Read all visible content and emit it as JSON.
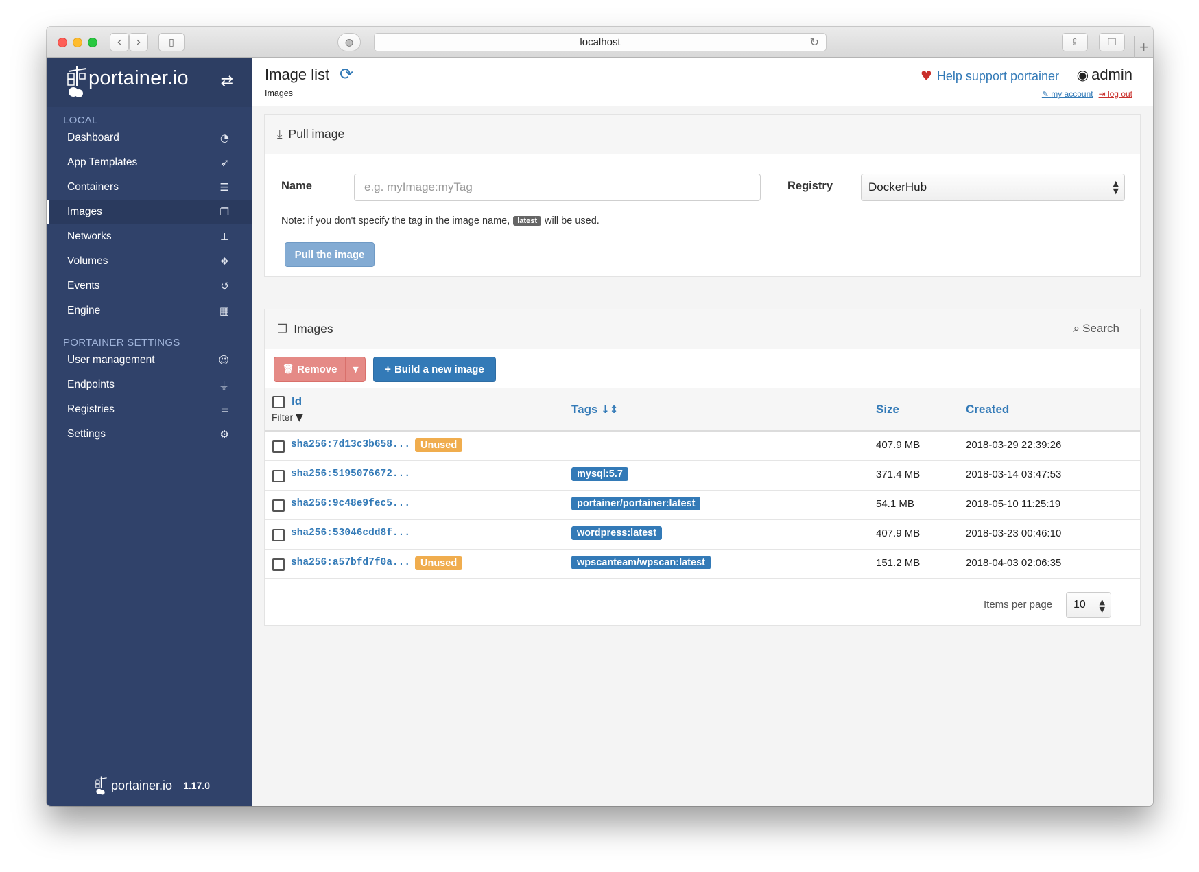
{
  "browser": {
    "url": "localhost"
  },
  "sidebar": {
    "brand": "portainer.io",
    "sections": {
      "local": "LOCAL",
      "settings": "PORTAINER SETTINGS"
    },
    "items": [
      {
        "label": "Dashboard",
        "icon": "tachometer-icon"
      },
      {
        "label": "App Templates",
        "icon": "rocket-icon"
      },
      {
        "label": "Containers",
        "icon": "server-icon"
      },
      {
        "label": "Images",
        "icon": "clone-icon",
        "active": true
      },
      {
        "label": "Networks",
        "icon": "sitemap-icon"
      },
      {
        "label": "Volumes",
        "icon": "cubes-icon"
      },
      {
        "label": "Events",
        "icon": "history-icon"
      },
      {
        "label": "Engine",
        "icon": "th-icon"
      },
      {
        "label": "User management",
        "icon": "users-icon"
      },
      {
        "label": "Endpoints",
        "icon": "plug-icon"
      },
      {
        "label": "Registries",
        "icon": "database-icon"
      },
      {
        "label": "Settings",
        "icon": "cogs-icon"
      }
    ],
    "footer": {
      "brand": "portainer.io",
      "version": "1.17.0"
    }
  },
  "header": {
    "title": "Image list",
    "breadcrumb": "Images",
    "help_link": "Help support portainer",
    "user": "admin",
    "my_account": "my account",
    "log_out": "log out"
  },
  "pull": {
    "title": "Pull image",
    "name_label": "Name",
    "name_placeholder": "e.g. myImage:myTag",
    "registry_label": "Registry",
    "registry_value": "DockerHub",
    "note_before": "Note: if you don't specify the tag in the image name,",
    "note_badge": "latest",
    "note_after": "will be used.",
    "button": "Pull the image"
  },
  "images": {
    "title": "Images",
    "search": "Search",
    "remove_button": "Remove",
    "build_button": "Build a new image",
    "columns": {
      "id": "Id",
      "filter": "Filter",
      "tags": "Tags",
      "size": "Size",
      "created": "Created"
    },
    "rows": [
      {
        "id": "sha256:7d13c3b658...",
        "unused": "Unused",
        "tag": "",
        "size": "407.9 MB",
        "created": "2018-03-29 22:39:26"
      },
      {
        "id": "sha256:5195076672...",
        "unused": "",
        "tag": "mysql:5.7",
        "size": "371.4 MB",
        "created": "2018-03-14 03:47:53"
      },
      {
        "id": "sha256:9c48e9fec5...",
        "unused": "",
        "tag": "portainer/portainer:latest",
        "size": "54.1 MB",
        "created": "2018-05-10 11:25:19"
      },
      {
        "id": "sha256:53046cdd8f...",
        "unused": "",
        "tag": "wordpress:latest",
        "size": "407.9 MB",
        "created": "2018-03-23 00:46:10"
      },
      {
        "id": "sha256:a57bfd7f0a...",
        "unused": "Unused",
        "tag": "wpscanteam/wpscan:latest",
        "size": "151.2 MB",
        "created": "2018-04-03 02:06:35"
      }
    ],
    "items_per_page_label": "Items per page",
    "items_per_page_value": "10"
  },
  "colors": {
    "sidebar": "#30426a",
    "primary": "#337ab7",
    "danger": "#e58a86",
    "warning": "#f0ad4e"
  }
}
